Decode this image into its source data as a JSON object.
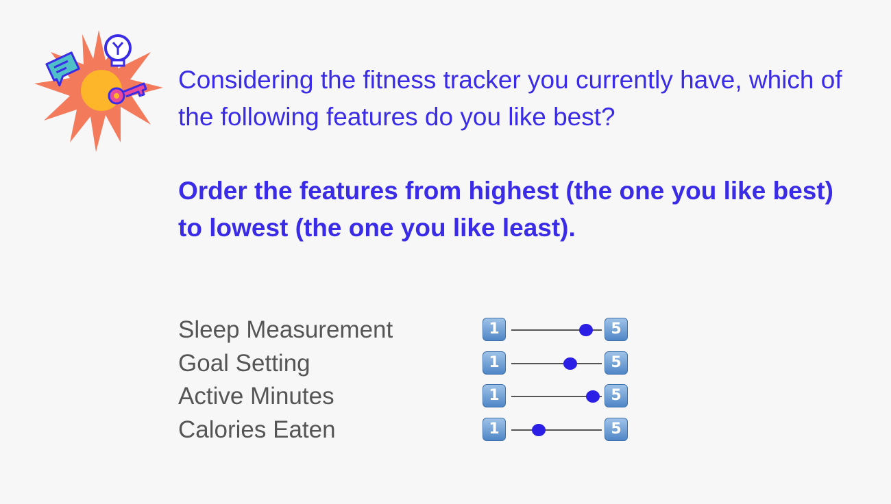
{
  "colors": {
    "accent": "#3a2be6",
    "thumb": "#2b1fe6",
    "label": "#555555",
    "burst": "#f47a5c",
    "burst_center": "#fdb52a",
    "key_icon": "#e94a9c",
    "bulb_icon": "#3a2be6",
    "chat_icon": "#4fbfc8"
  },
  "illustration": {
    "icons": [
      "starburst-icon",
      "speech-bubble-icon",
      "lightbulb-icon",
      "key-icon"
    ]
  },
  "question": {
    "text": "Considering the fitness tracker you currently have, which of the following features do you like best?",
    "instruction": "Order the features from highest (the one you like best) to lowest (the one you like least)."
  },
  "scale": {
    "min": "1",
    "max": "5"
  },
  "features": [
    {
      "label": "Sleep Measurement",
      "value": 4.3
    },
    {
      "label": "Goal Setting",
      "value": 3.6
    },
    {
      "label": "Active Minutes",
      "value": 4.6
    },
    {
      "label": "Calories Eaten",
      "value": 2.2
    }
  ]
}
